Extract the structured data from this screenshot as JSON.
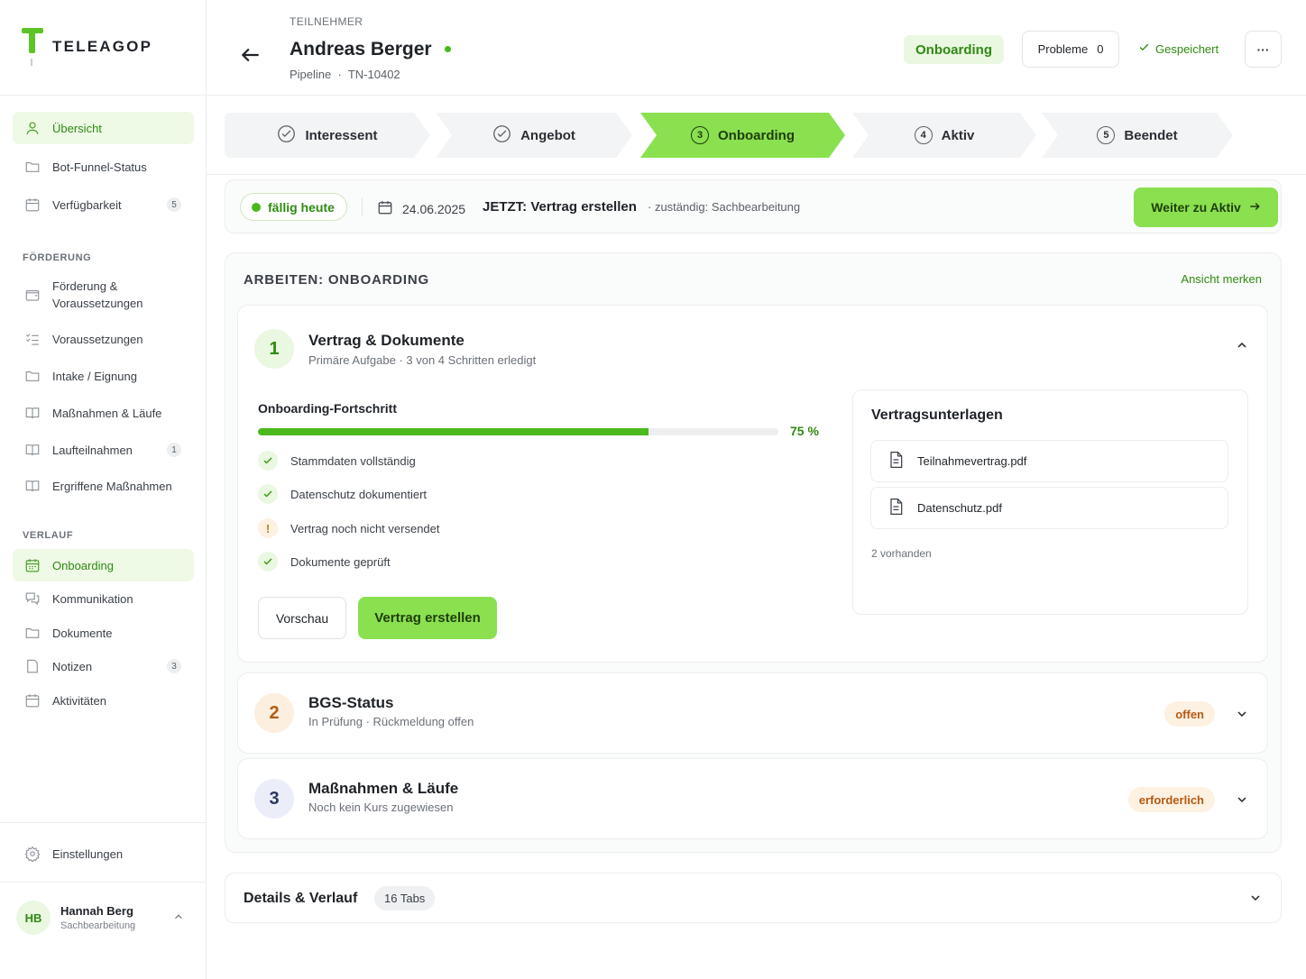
{
  "brand": {
    "name": "TELEAGOP"
  },
  "sidebar": {
    "top_items": [
      {
        "label": "Übersicht",
        "icon": "user-icon"
      },
      {
        "label": "Bot-Funnel-Status",
        "icon": "folder-icon"
      },
      {
        "label": "Verfügbarkeit",
        "icon": "calendar-icon",
        "badge": "5"
      }
    ],
    "section_foerderung": "FÖRDERUNG",
    "foerderung_items": [
      {
        "label": "Förderung &",
        "label2": "Voraussetzungen",
        "icon": "wallet-icon"
      },
      {
        "label": "Voraussetzungen",
        "icon": "checklist-icon"
      },
      {
        "label": "Intake / Eignung",
        "icon": "folder-icon"
      },
      {
        "label": "Maßnahmen & Läufe",
        "icon": "book-icon"
      },
      {
        "label": "Laufteilnahmen",
        "icon": "book-icon",
        "badge": "1"
      },
      {
        "label": "Ergriffene Maßnahmen",
        "icon": "book-icon"
      }
    ],
    "section_verlauf": "VERLAUF",
    "verlauf_items": [
      {
        "label": "Onboarding",
        "icon": "calendar-icon"
      },
      {
        "label": "Kommunikation",
        "icon": "chat-icon"
      },
      {
        "label": "Dokumente",
        "icon": "folder-icon"
      },
      {
        "label": "Notizen",
        "icon": "note-icon",
        "badge": "3"
      },
      {
        "label": "Aktivitäten",
        "icon": "calendar-icon"
      }
    ],
    "settings": "Einstellungen",
    "user": {
      "initials": "HB",
      "name": "Hannah Berg",
      "role": "Sachbearbeitung"
    }
  },
  "header": {
    "eyebrow": "TEILNEHMER",
    "name": "Andreas Berger",
    "pipeline": "Pipeline",
    "separator": "·",
    "id": "TN-10402",
    "stage_pill": "Onboarding",
    "problems_label": "Probleme",
    "problems_count": "0",
    "saved_label": "Gespeichert",
    "more": "···"
  },
  "stepper": [
    {
      "label": "Interessent",
      "marker": ""
    },
    {
      "label": "Angebot",
      "marker": ""
    },
    {
      "label": "Onboarding",
      "marker": "3"
    },
    {
      "label": "Aktiv",
      "marker": "4"
    },
    {
      "label": "Beendet",
      "marker": "5"
    }
  ],
  "statusbar": {
    "due": "fällig heute",
    "date": "24.06.2025",
    "now": "JETZT: Vertrag erstellen",
    "responsible": "· zuständig: Sachbearbeitung",
    "next_button": "Weiter zu Aktiv"
  },
  "work": {
    "title": "ARBEITEN: ONBOARDING",
    "remember": "Ansicht merken",
    "task1": {
      "num": "1",
      "title": "Vertrag & Dokumente",
      "subtitle": "Primäre Aufgabe · 3 von 4 Schritten erledigt",
      "progress_label": "Onboarding-Fortschritt",
      "progress_percent": 75,
      "progress_text": "75 %",
      "checks": [
        {
          "label": "Stammdaten vollständig",
          "state": "done"
        },
        {
          "label": "Datenschutz dokumentiert",
          "state": "done"
        },
        {
          "label": "Vertrag noch nicht versendet",
          "state": "warn"
        },
        {
          "label": "Dokumente geprüft",
          "state": "done"
        }
      ],
      "warn_mark": "!",
      "preview_button": "Vorschau",
      "create_button": "Vertrag erstellen",
      "docs": {
        "title": "Vertragsunterlagen",
        "files": [
          "Teilnahmevertrag.pdf",
          "Datenschutz.pdf"
        ],
        "count": "2 vorhanden"
      }
    },
    "task2": {
      "num": "2",
      "title": "BGS-Status",
      "subtitle": "In Prüfung · Rückmeldung offen",
      "status": "offen"
    },
    "task3": {
      "num": "3",
      "title": "Maßnahmen & Läufe",
      "subtitle": "Noch kein Kurs zugewiesen",
      "status": "erforderlich"
    }
  },
  "details": {
    "title": "Details & Verlauf",
    "tabs": "16 Tabs"
  },
  "colors": {
    "accent": "#8ae04f",
    "accent_dark": "#2f8a12",
    "warn": "#b45b12"
  }
}
